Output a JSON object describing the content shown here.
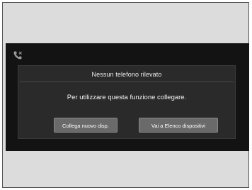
{
  "screen": {
    "status_icon": "phone-handset-icon",
    "dialog": {
      "title": "Nessun telefono rilevato",
      "message": "Per utilizzare questa funzione collegare.",
      "buttons": {
        "connect_label": "Collega nuovo disp.",
        "devices_label": "Vai a Elenco dispositivi"
      }
    }
  },
  "colors": {
    "screen_background": "#131313",
    "dialog_background": "#2a2a2a",
    "button_background": "#6a6a6a",
    "text": "#f2f2f2"
  }
}
